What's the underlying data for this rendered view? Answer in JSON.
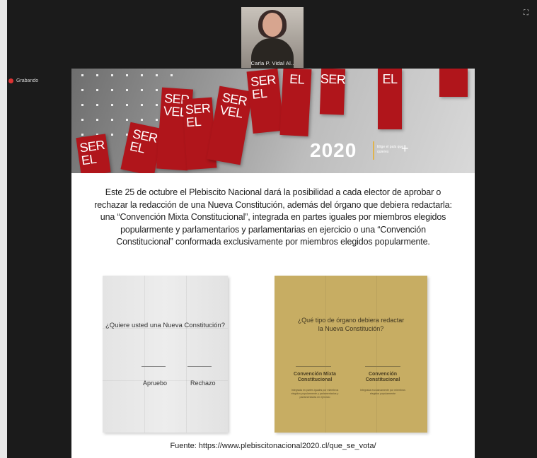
{
  "window": {
    "participant_name": "Carla P. Vidal Al..",
    "recording_label": "Grabando",
    "fullscreen_glyph": "⛶"
  },
  "slide": {
    "banner": {
      "flag_texts": [
        "SER\nEL",
        "SER\nEL",
        "SER\nVEL",
        "SER\nEL",
        "SER\nVEL",
        "SER\nEL",
        "EL",
        "SER",
        "EL"
      ],
      "year": "2020",
      "tagline": "Elige el país que quieres",
      "plus": "+"
    },
    "body_text": "Este 25 de octubre el Plebiscito Nacional dará la posibilidad a cada elector de aprobar o rechazar la redacción de una Nueva Constitución, además del órgano que debiera redactarla: una “Convención Mixta Constitucional”, integrada en partes iguales por miembros elegidos popularmente y parlamentarios y parlamentarias en ejercicio o una “Convención Constitucional” conformada exclusivamente por miembros elegidos popularmente.",
    "card_question": {
      "question": "¿Quiere usted una Nueva Constitución?",
      "option_1": "Apruebo",
      "option_2": "Rechazo"
    },
    "card_type": {
      "question": "¿Qué tipo de órgano debiera redactar la Nueva Constitución?",
      "choice_1_title": "Convención Mixta Constitucional",
      "choice_1_desc": "Integrada en partes iguales por miembros elegidos popularmente y parlamentarios y parlamentarias en ejercicio",
      "choice_2_title": "Convención Constitucional",
      "choice_2_desc": "Integrada exclusivamente por miembros elegidos popularmente"
    },
    "source": "Fuente: https://www.plebiscitonacional2020.cl/que_se_vota/"
  },
  "colors": {
    "background": "#1b1b1b",
    "servel_red": "#b0151b",
    "gold_card": "#c7ad63",
    "recording_dot": "#dd3333"
  }
}
